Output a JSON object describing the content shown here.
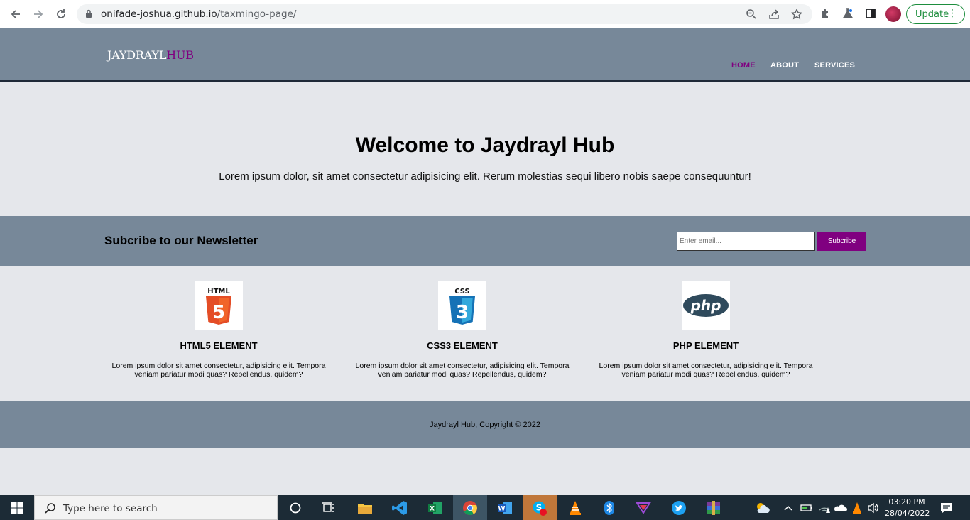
{
  "browser": {
    "url_host": "onifade-joshua.github.io",
    "url_path": "/taxmingo-page/",
    "update_label": "Update"
  },
  "site": {
    "logo_main": "JAYDRAYL",
    "logo_accent": "HUB",
    "nav": [
      {
        "label": "HOME",
        "active": true
      },
      {
        "label": "ABOUT",
        "active": false
      },
      {
        "label": "SERVICES",
        "active": false
      }
    ],
    "hero": {
      "title": "Welcome to Jaydrayl Hub",
      "text": "Lorem ipsum dolor, sit amet consectetur adipisicing elit. Rerum molestias sequi libero nobis saepe consequuntur!"
    },
    "newsletter": {
      "heading": "Subcribe to our Newsletter",
      "placeholder": "Enter email...",
      "button": "Subcribe"
    },
    "features": [
      {
        "icon": "html5-icon",
        "title": "HTML5 ELEMENT",
        "text": "Lorem ipsum dolor sit amet consectetur, adipisicing elit. Tempora veniam pariatur modi quas? Repellendus, quidem?"
      },
      {
        "icon": "css3-icon",
        "title": "CSS3 ELEMENT",
        "text": "Lorem ipsum dolor sit amet consectetur, adipisicing elit. Tempora veniam pariatur modi quas? Repellendus, quidem?"
      },
      {
        "icon": "php-icon",
        "title": "PHP ELEMENT",
        "text": "Lorem ipsum dolor sit amet consectetur, adipisicing elit. Tempora veniam pariatur modi quas? Repellendus, quidem?"
      }
    ],
    "footer": "Jaydrayl Hub, Copyright © 2022",
    "colors": {
      "header_bg": "#778899",
      "accent": "#800080",
      "page_bg": "#e5e7eb"
    }
  },
  "taskbar": {
    "search_placeholder": "Type here to search",
    "time": "03:20 PM",
    "date": "28/04/2022"
  }
}
